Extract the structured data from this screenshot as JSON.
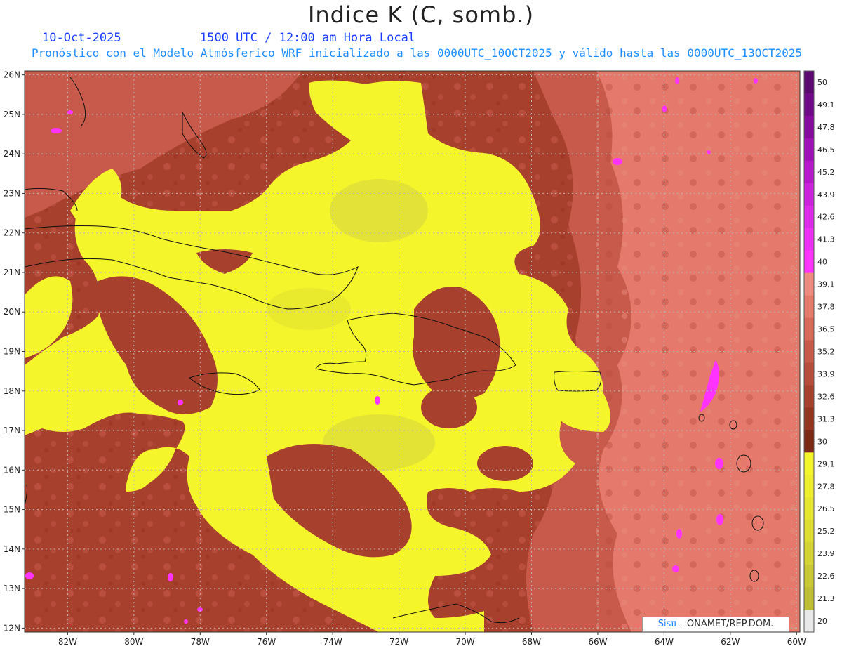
{
  "header": {
    "title": "Indice K (C, somb.)",
    "date": "10-Oct-2025",
    "time": "1500 UTC / 12:00 am Hora Local",
    "subtitle": "Pronóstico con el Modelo Atmósferico WRF inicializado a las 0000UTC_10OCT2025 y válido hasta las  0000UTC_13OCT2025"
  },
  "map": {
    "lon_range": [
      -83.3,
      -59.9
    ],
    "lat_range": [
      11.9,
      26.1
    ],
    "lon_ticks": [
      "82W",
      "80W",
      "78W",
      "76W",
      "74W",
      "72W",
      "70W",
      "68W",
      "66W",
      "64W",
      "62W",
      "60W"
    ],
    "lat_ticks": [
      "12N",
      "13N",
      "14N",
      "15N",
      "16N",
      "17N",
      "18N",
      "19N",
      "20N",
      "21N",
      "22N",
      "23N",
      "24N",
      "25N",
      "26N"
    ],
    "grid": true,
    "colors": {
      "dark": "#a8402e",
      "mid": "#c85a4c",
      "light": "#e57a6c",
      "yellow": "#f5f52c",
      "yellow_dark": "#dede3a",
      "magenta": "#ff33ff",
      "coast": "#111111"
    }
  },
  "colorbar": {
    "labels": [
      "50",
      "49.1",
      "47.8",
      "46.5",
      "45.2",
      "43.9",
      "42.6",
      "41.3",
      "40",
      "39.1",
      "37.8",
      "36.5",
      "35.2",
      "33.9",
      "32.6",
      "31.3",
      "30",
      "29.1",
      "27.8",
      "26.5",
      "25.2",
      "23.9",
      "22.6",
      "21.3",
      "20"
    ],
    "colors": [
      "#5a0a6e",
      "#6e0a86",
      "#880a9e",
      "#a010b8",
      "#b818cc",
      "#cc22dd",
      "#dd2aea",
      "#ee30f6",
      "#ff33ff",
      "#f08a80",
      "#e57a6c",
      "#d8685a",
      "#c85a4c",
      "#b84c3c",
      "#a8402e",
      "#963422",
      "#7a2a16",
      "#f5f52c",
      "#eeee2e",
      "#e6e630",
      "#dede32",
      "#d4d434",
      "#c8c834",
      "#bebe34",
      "#e8e8e8"
    ]
  },
  "credit": {
    "brand": "Sisπ",
    "text": " – ONAMET/REP.DOM."
  }
}
